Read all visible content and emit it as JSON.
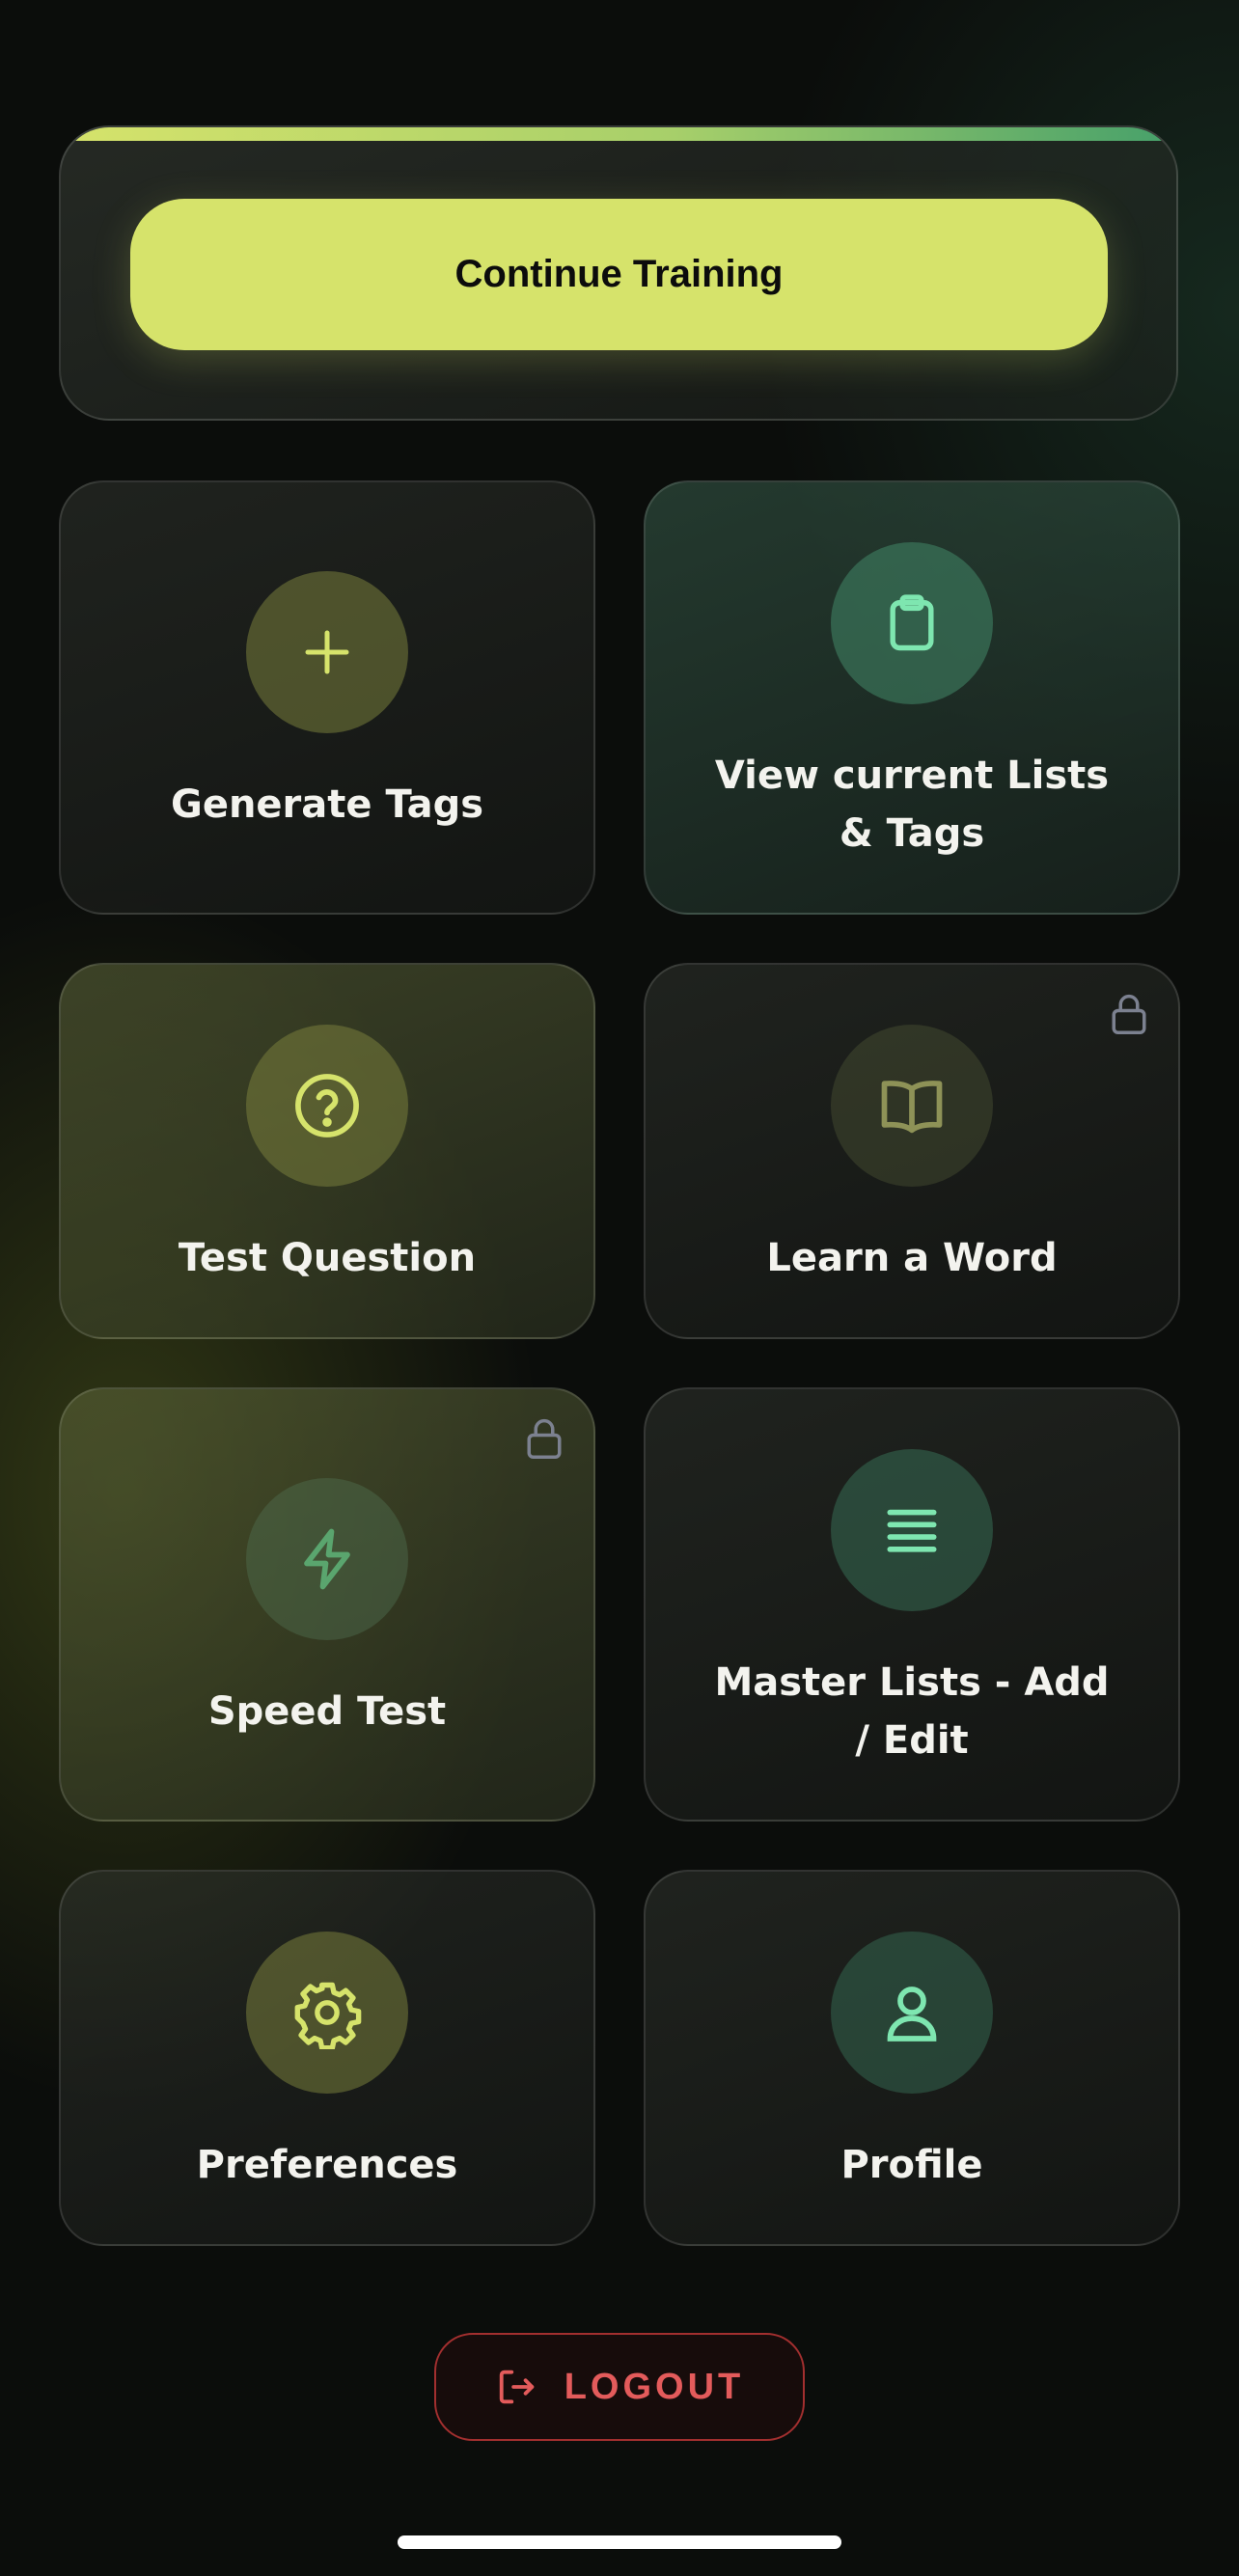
{
  "hero": {
    "continue_label": "Continue Training",
    "progress_percent": 100
  },
  "tiles": [
    {
      "label": "Generate Tags",
      "icon": "plus-icon",
      "locked": false
    },
    {
      "label": "View current Lists & Tags",
      "icon": "clipboard-icon",
      "locked": false
    },
    {
      "label": "Test Question",
      "icon": "question-circle-icon",
      "locked": false
    },
    {
      "label": "Learn a Word",
      "icon": "book-open-icon",
      "locked": true
    },
    {
      "label": "Speed Test",
      "icon": "lightning-icon",
      "locked": true
    },
    {
      "label": "Master Lists - Add / Edit",
      "icon": "list-lines-icon",
      "locked": false
    },
    {
      "label": "Preferences",
      "icon": "gear-icon",
      "locked": false
    },
    {
      "label": "Profile",
      "icon": "user-icon",
      "locked": false
    }
  ],
  "logout": {
    "label": "LOGOUT",
    "icon": "logout-icon"
  },
  "colors": {
    "accent_lime": "#d6e36b",
    "accent_mint": "#7ee6b0",
    "danger": "#e35b5b"
  }
}
